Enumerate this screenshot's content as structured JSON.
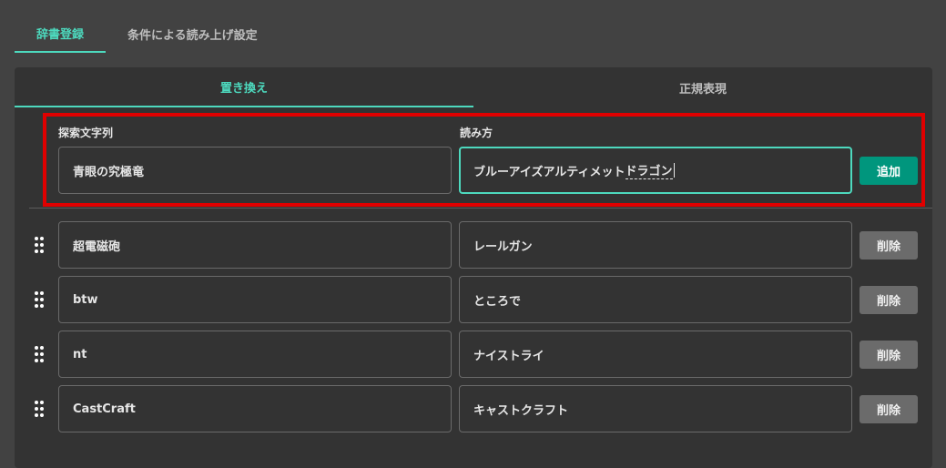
{
  "tabs": {
    "dictionary": "辞書登録",
    "conditional_reading": "条件による読み上げ設定"
  },
  "sub_tabs": {
    "replace": "置き換え",
    "regex": "正規表現"
  },
  "new_entry": {
    "search_label": "探索文字列",
    "reading_label": "読み方",
    "search_value": "青眼の究極竜",
    "reading_value_committed": "ブルーアイズアルティメット",
    "reading_value_composing": "ドラゴン",
    "add_label": "追加"
  },
  "entries": [
    {
      "search": "超電磁砲",
      "reading": "レールガン",
      "delete_label": "削除"
    },
    {
      "search": "btw",
      "reading": "ところで",
      "delete_label": "削除"
    },
    {
      "search": "nt",
      "reading": "ナイストライ",
      "delete_label": "削除"
    },
    {
      "search": "CastCraft",
      "reading": "キャストクラフト",
      "delete_label": "削除"
    }
  ],
  "colors": {
    "accent": "#4dd9be",
    "add_button": "#00967d",
    "highlight": "#e00000",
    "background": "#424242",
    "panel": "#333333"
  }
}
